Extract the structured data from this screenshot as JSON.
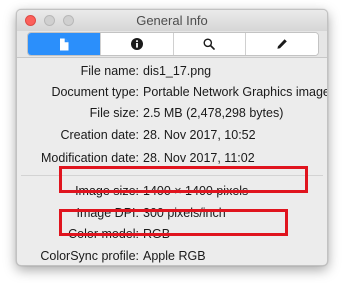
{
  "window": {
    "title": "General Info"
  },
  "tabs": [
    {
      "icon": "document-icon",
      "active": true
    },
    {
      "icon": "info-icon",
      "active": false
    },
    {
      "icon": "search-icon",
      "active": false
    },
    {
      "icon": "pencil-icon",
      "active": false
    }
  ],
  "info": {
    "file_name": {
      "label": "File name:",
      "value": "dis1_17.png"
    },
    "document_type": {
      "label": "Document type:",
      "value": "Portable Network Graphics image"
    },
    "file_size": {
      "label": "File size:",
      "value": "2.5 MB (2,478,298 bytes)"
    },
    "creation_date": {
      "label": "Creation date:",
      "value": "28. Nov 2017, 10:52"
    },
    "modification_date": {
      "label": "Modification date:",
      "value": "28. Nov 2017, 11:02"
    },
    "image_size": {
      "label": "Image size:",
      "value": "1400 × 1400 pixels"
    },
    "image_dpi": {
      "label": "Image DPI:",
      "value": "300 pixels/inch"
    },
    "color_model": {
      "label": "Color model:",
      "value": "RGB"
    },
    "colorsync_profile": {
      "label": "ColorSync profile:",
      "value": "Apple RGB"
    }
  },
  "colors": {
    "active_tab": "#2b8ffb",
    "highlight_box": "#e0141e",
    "close_button": "#fc605b"
  }
}
